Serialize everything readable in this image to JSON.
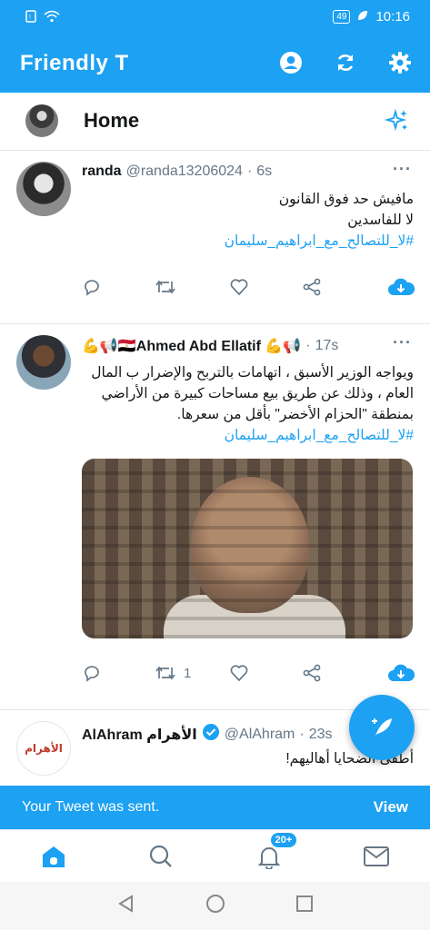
{
  "status": {
    "battery": "49",
    "time": "10:16"
  },
  "app": {
    "title": "Friendly T",
    "icons": [
      "account-icon",
      "sync-icon",
      "settings-icon"
    ],
    "accent": "#1da1f2"
  },
  "home": {
    "title": "Home",
    "icon": "sparkle-icon"
  },
  "tweets": [
    {
      "name": "randa",
      "handle": "@randa13206024",
      "sep": "·",
      "time": "6s",
      "lines": [
        "مافيش حد فوق القانون",
        "لا للفاسدين"
      ],
      "hashtag": "#لا_للتصالح_مع_ابراهيم_سليمان"
    },
    {
      "name": "💪📢🇪🇬Ahmed Abd Ellatif 💪📢",
      "sep": "·",
      "time": "17s",
      "lines": [
        "ويواجه الوزير الأسبق ، اتهامات بالتربح والإضرار ب المال العام ، وذلك عن طريق بيع مساحات كبيرة من الأراضي بمنطقة \"الحزام الأخضر\" بأقل من سعرها."
      ],
      "hashtag": "#لا_للتصالح_مع_ابراهيم_سليمان",
      "retweets": "1"
    },
    {
      "name": "AlAhram الأهرام",
      "handle": "@AlAhram",
      "sep": "·",
      "time": "23s",
      "lines": [
        "أطفئ الضحايا أهاليهم!"
      ],
      "avatar_text": "الأهرام"
    }
  ],
  "snackbar": {
    "message": "Your Tweet was sent.",
    "action": "View"
  },
  "bottom_nav": {
    "badge": "20+"
  }
}
